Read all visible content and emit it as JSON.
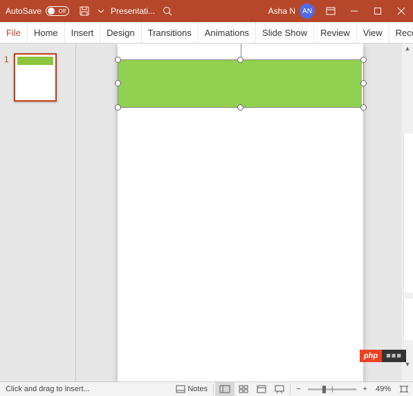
{
  "titlebar": {
    "autosave_label": "AutoSave",
    "autosave_state": "Off",
    "doc_title": "Presentati...",
    "user_name": "Asha N",
    "user_initials": "AN"
  },
  "ribbon": {
    "tabs": [
      "File",
      "Home",
      "Insert",
      "Design",
      "Transitions",
      "Animations",
      "Slide Show",
      "Review",
      "View",
      "Recordi"
    ]
  },
  "thumbs": {
    "slides": [
      {
        "num": "1"
      }
    ]
  },
  "status": {
    "message": "Click and drag to insert...",
    "notes_label": "Notes",
    "zoom_pct": "49%"
  },
  "watermark": {
    "left": "php",
    "right": "■■■"
  },
  "colors": {
    "accent": "#b7472a",
    "shape_fill": "#92d050"
  }
}
